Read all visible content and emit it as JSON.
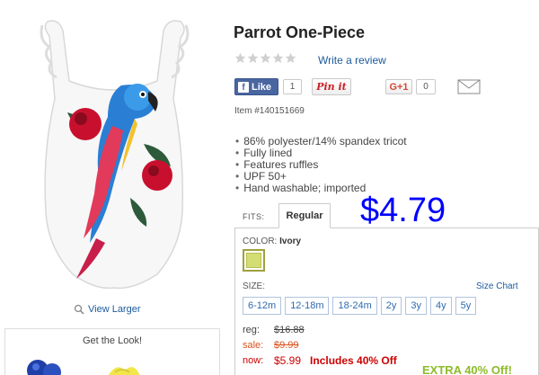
{
  "product": {
    "title": "Parrot One-Piece",
    "write_review": "Write a review",
    "item_number": "Item #140151669",
    "features": [
      "86% polyester/14% spandex tricot",
      "Fully lined",
      "Features ruffles",
      "UPF 50+",
      "Hand washable; imported"
    ],
    "rating_stars": 0
  },
  "social": {
    "like_label": "Like",
    "like_count": "1",
    "pinit_label": "Pin it",
    "gplus_label": "G+1",
    "gplus_count": "0"
  },
  "gallery": {
    "view_larger": "View Larger",
    "get_the_look": "Get the Look!"
  },
  "fits": {
    "label": "FITS:",
    "active_tab": "Regular"
  },
  "price_overlay": "$4.79",
  "color": {
    "label": "COLOR:",
    "value": "Ivory",
    "swatch_hex": "#d4dd74"
  },
  "size": {
    "label": "SIZE:",
    "chart_link": "Size Chart",
    "options": [
      "6-12m",
      "12-18m",
      "18-24m",
      "2y",
      "3y",
      "4y",
      "5y"
    ]
  },
  "pricing": {
    "reg_label": "reg:",
    "reg_value": "$16.88",
    "sale_label": "sale:",
    "sale_value": "$9.99",
    "now_label": "now:",
    "now_value": "$5.99",
    "promo": "Includes 40% Off"
  },
  "extra_banner": "EXTRA 40% Off!",
  "colors": {
    "link": "#1a5a9c",
    "price_overlay": "#0000ff",
    "now_red": "#cc0000",
    "sale_orange": "#d9531e",
    "extra_green": "#8dbb28"
  }
}
